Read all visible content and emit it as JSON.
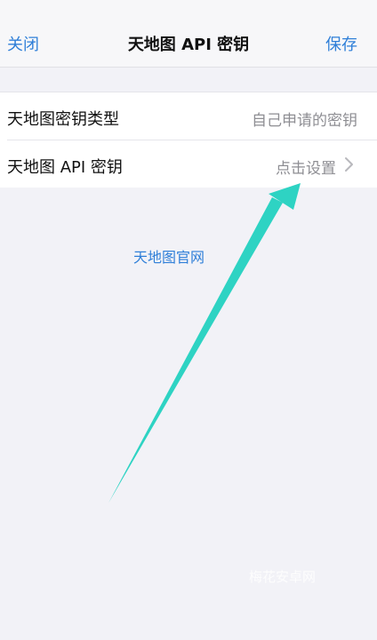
{
  "nav": {
    "left": "关闭",
    "title": "天地图 API 密钥",
    "right": "保存"
  },
  "settings": {
    "rows": [
      {
        "label": "天地图密钥类型",
        "value": "自己申请的密钥"
      },
      {
        "label": "天地图 API 密钥",
        "value": "点击设置"
      }
    ]
  },
  "link": {
    "label": "天地图官网"
  },
  "annotation": {
    "color": "#2ed3c3"
  },
  "watermark": "梅花安卓网",
  "colors": {
    "accent": "#2f7fd8",
    "background": "#f2f2f7",
    "secondary_text": "#8e8e93"
  }
}
